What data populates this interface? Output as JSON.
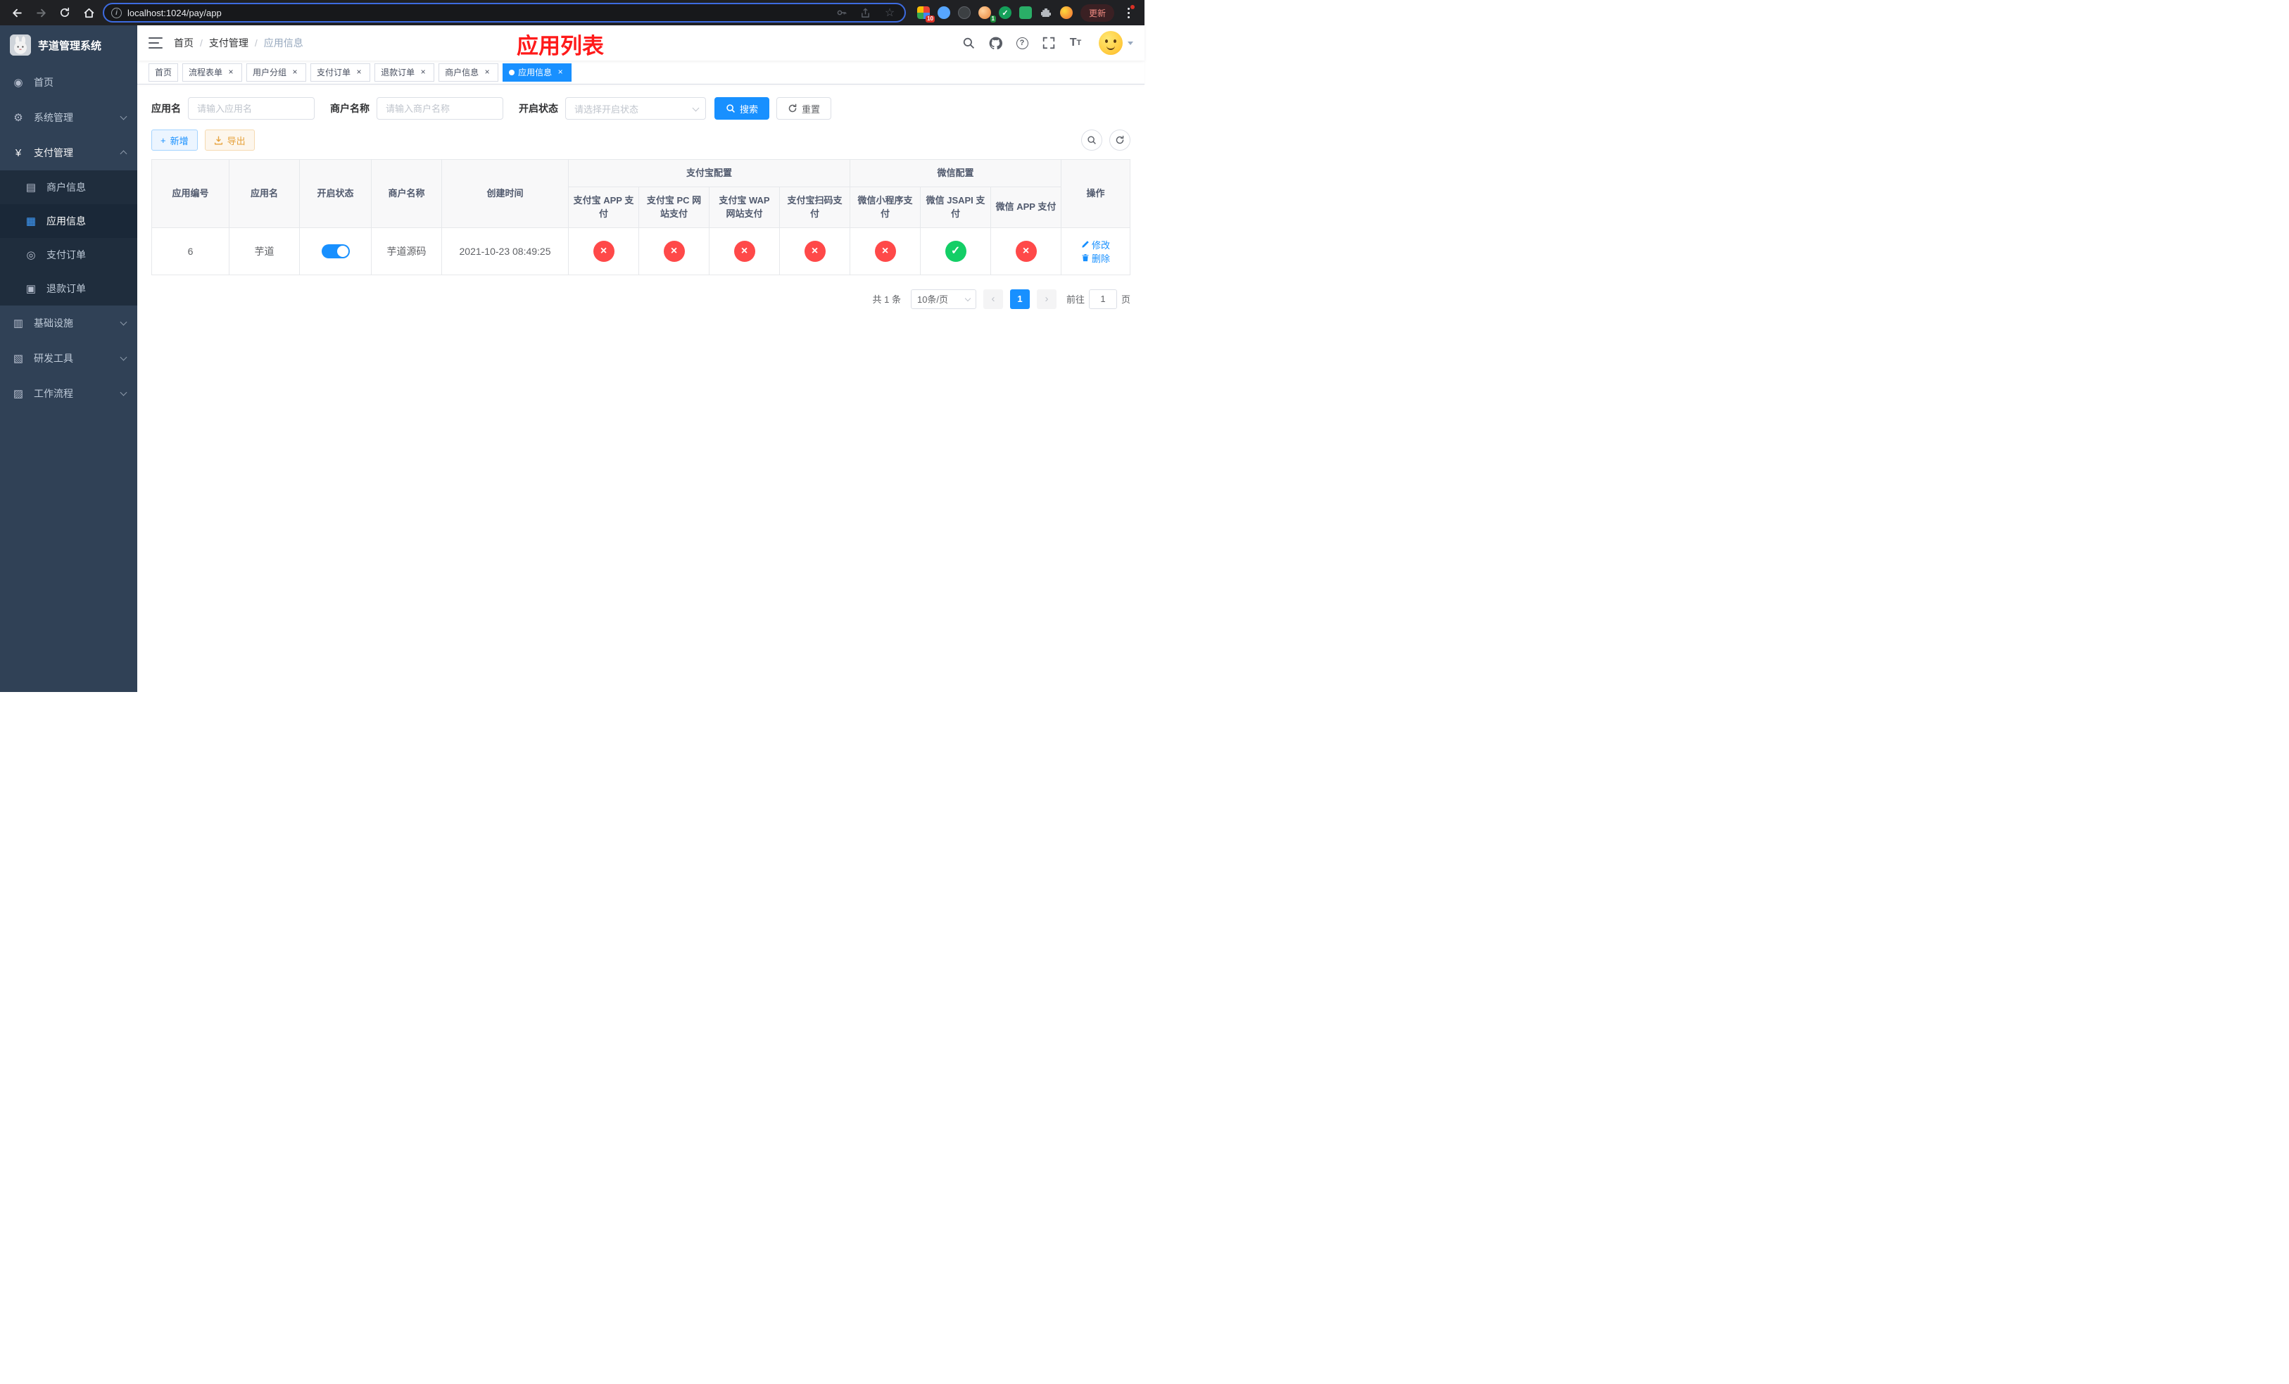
{
  "browser": {
    "url": "localhost:1024/pay/app",
    "update_button": "更新",
    "extensions_badge": "10",
    "avatar_badge": "1"
  },
  "icons": {
    "dashboard": "◉",
    "gear": "⚙",
    "yen": "¥",
    "merchant": "▤",
    "app": "▦",
    "order": "◎",
    "refund": "▣",
    "infra": "▥",
    "tools": "▧",
    "workflow": "▨",
    "close": "×",
    "plus": "+",
    "check": "✓",
    "cross": "×",
    "info": "i",
    "question": "?",
    "star": "☆",
    "prev": "‹",
    "next": "›",
    "font_big": "T",
    "font_small": "T"
  },
  "colors": {
    "primary": "#1890ff",
    "danger": "#ff4949",
    "success": "#13ce66",
    "warning": "#e6a23c",
    "overlay_title": "#ff1a1a"
  },
  "sidebar": {
    "title": "芋道管理系统",
    "items": [
      {
        "label": "首页"
      },
      {
        "label": "系统管理"
      },
      {
        "label": "支付管理"
      },
      {
        "label": "商户信息"
      },
      {
        "label": "应用信息"
      },
      {
        "label": "支付订单"
      },
      {
        "label": "退款订单"
      },
      {
        "label": "基础设施"
      },
      {
        "label": "研发工具"
      },
      {
        "label": "工作流程"
      }
    ]
  },
  "header": {
    "breadcrumb": [
      "首页",
      "支付管理",
      "应用信息"
    ],
    "overlay_title": "应用列表"
  },
  "tags": [
    {
      "label": "首页"
    },
    {
      "label": "流程表单"
    },
    {
      "label": "用户分组"
    },
    {
      "label": "支付订单"
    },
    {
      "label": "退款订单"
    },
    {
      "label": "商户信息"
    },
    {
      "label": "应用信息"
    }
  ],
  "filters": {
    "app_name_label": "应用名",
    "app_name_placeholder": "请输入应用名",
    "merchant_label": "商户名称",
    "merchant_placeholder": "请输入商户名称",
    "status_label": "开启状态",
    "status_placeholder": "请选择开启状态",
    "search_button": "搜索",
    "reset_button": "重置"
  },
  "toolbar": {
    "add_button": "新增",
    "export_button": "导出"
  },
  "table": {
    "group_alipay": "支付宝配置",
    "group_wechat": "微信配置",
    "columns": [
      "应用编号",
      "应用名",
      "开启状态",
      "商户名称",
      "创建时间",
      "支付宝 APP 支付",
      "支付宝 PC 网站支付",
      "支付宝 WAP 网站支付",
      "支付宝扫码支付",
      "微信小程序支付",
      "微信 JSAPI 支付",
      "微信 APP 支付",
      "操作"
    ],
    "rows": [
      {
        "id": "6",
        "name": "芋道",
        "enabled": true,
        "merchant": "芋道源码",
        "created": "2021-10-23 08:49:25",
        "channels": [
          "no",
          "no",
          "no",
          "no",
          "no",
          "yes",
          "no"
        ],
        "edit": "修改",
        "delete": "删除"
      }
    ]
  },
  "pagination": {
    "total": "共 1 条",
    "page_size": "10条/页",
    "current_page": "1",
    "goto_label": "前往",
    "goto_value": "1",
    "page_unit": "页"
  }
}
